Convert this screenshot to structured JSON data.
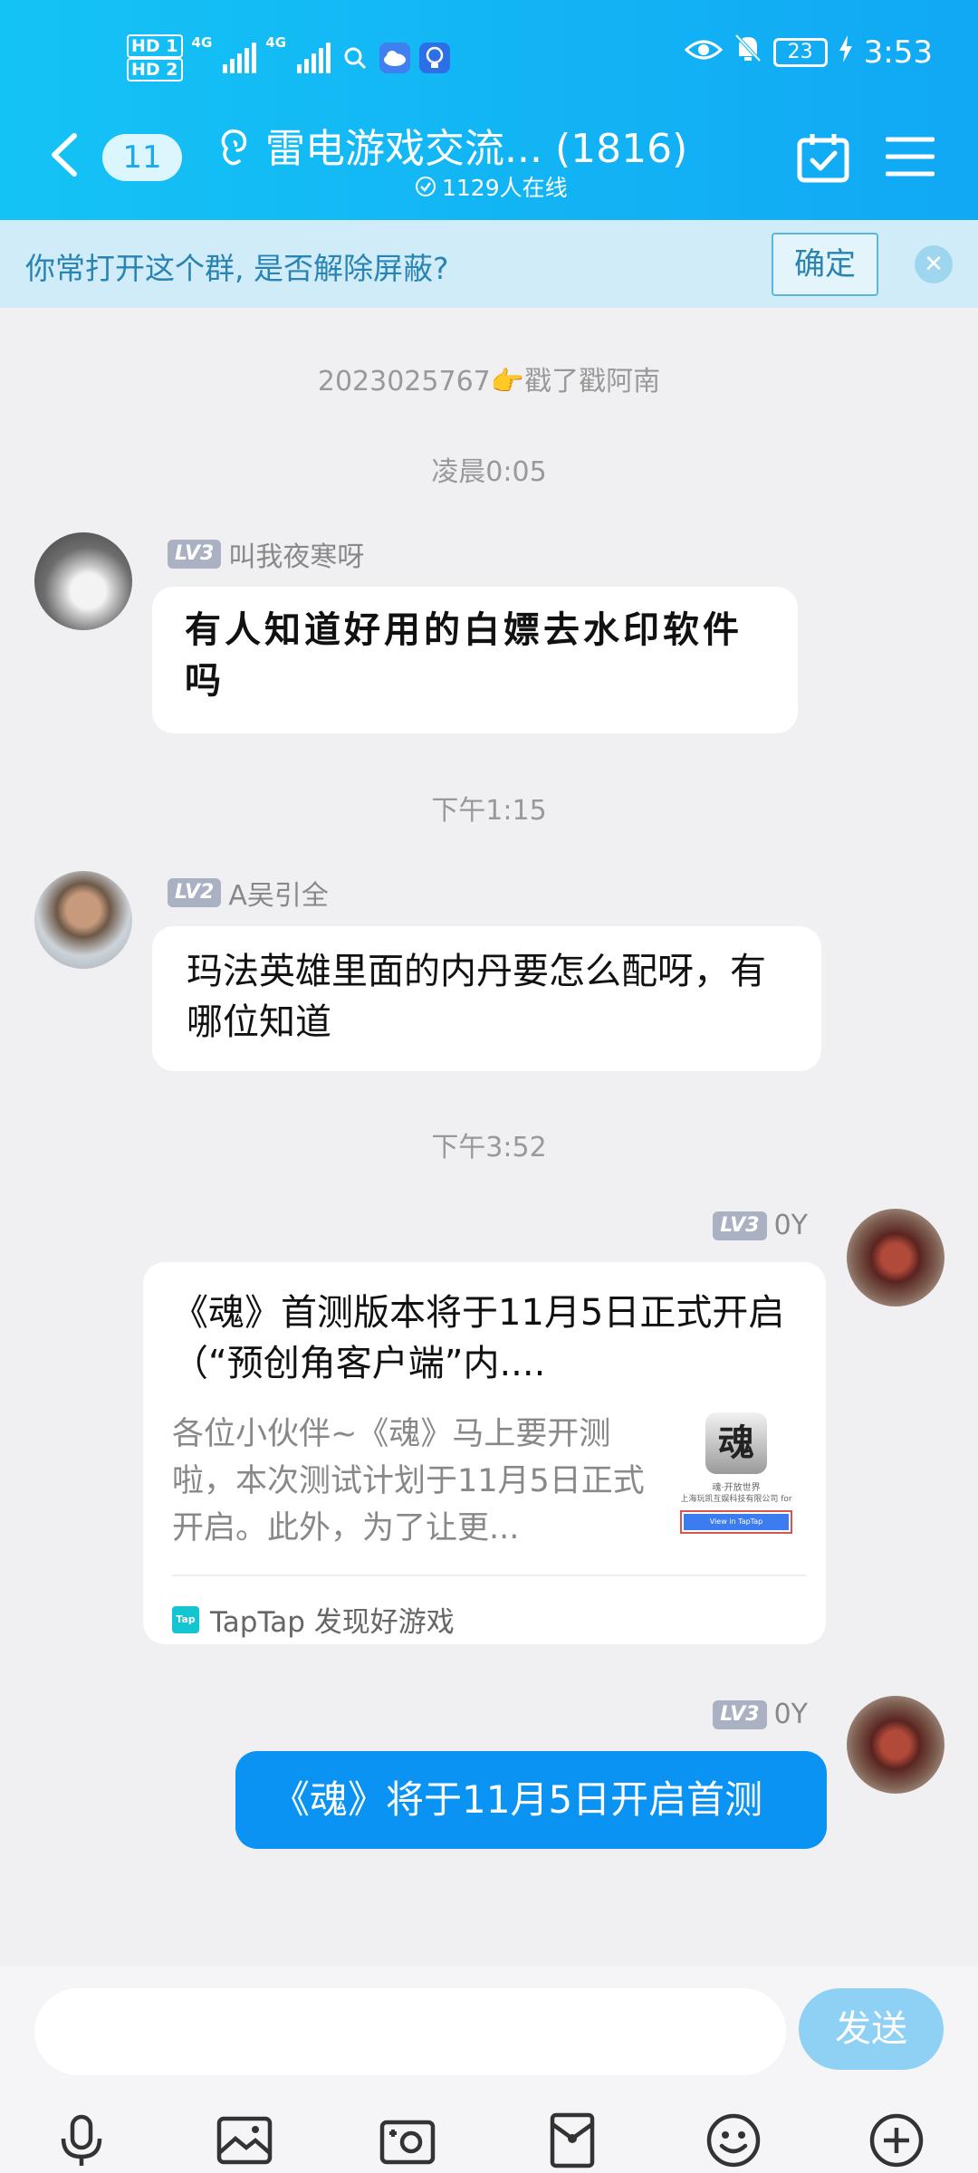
{
  "status_bar": {
    "hd1": "HD 1",
    "hd2": "HD 2",
    "net1": "4G",
    "net2": "4G",
    "battery": "23",
    "time": "3:53"
  },
  "header": {
    "unread_count": "11",
    "title": "雷电游戏交流... (1816)",
    "online": "1129人在线"
  },
  "notice": {
    "text": "你常打开这个群, 是否解除屏蔽?",
    "confirm_label": "确定"
  },
  "messages": {
    "poke": "2023025767👉戳了戳阿南",
    "time1": "凌晨0:05",
    "msg1": {
      "level": "LV3",
      "name": "叫我夜寒呀",
      "text": "有人知道好用的白嫖去水印软件吗"
    },
    "time2": "下午1:15",
    "msg2": {
      "level": "LV2",
      "name": "A吴引全",
      "text": "玛法英雄里面的内丹要怎么配呀，有哪位知道"
    },
    "time3": "下午3:52",
    "msg3": {
      "level": "LV3",
      "name": "0Y",
      "card_title": "《魂》首测版本将于11月5日正式开启（“预创角客户端”内....",
      "card_desc": "各位小伙伴~《魂》马上要开测啦，本次测试计划于11月5日正式开启。此外，为了让更...",
      "thumb_char": "魂",
      "thumb_caption": "魂·开放世界",
      "thumb_company": "上海玩凯互娱科技有限公司 for",
      "thumb_button": "View in TapTap",
      "source_logo": "Tap",
      "source": "TapTap 发现好游戏"
    },
    "msg4": {
      "level": "LV3",
      "name": "0Y",
      "text": "《魂》将于11月5日开启首测"
    }
  },
  "input": {
    "send_label": "发送"
  },
  "colors": {
    "header": "#14c3f5",
    "bubble_self": "#0a93f2",
    "send": "#8fd0f5"
  }
}
